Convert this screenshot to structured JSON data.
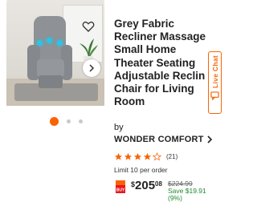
{
  "product": {
    "title_lines": [
      "Grey Fabric",
      "Recliner Massage",
      "Small Home",
      "Theater Seating",
      "Adjustable Reclin",
      "Chair for Living",
      "Room"
    ],
    "by_label": "by",
    "brand": "WONDER COMFORT",
    "rating": 4,
    "rating_count": "(21)",
    "limit_text": "Limit 10 per order",
    "price": {
      "dollar": "$",
      "whole": "205",
      "cents": "08"
    },
    "was_price": "$224.99",
    "save_amount": "Save $19.91",
    "save_percent": "(9%)"
  },
  "gallery": {
    "total_images": 3,
    "active_index": 0
  },
  "live_chat": {
    "label": "Live Chat"
  },
  "icons": {
    "favorite": "heart-icon",
    "next": "chevron-right-icon",
    "brand_chevron": "chevron-right-icon",
    "deal_badge": "buy-badge-icon",
    "chat": "chat-icon"
  },
  "colors": {
    "accent": "#f96302",
    "save": "#1f8a2e",
    "star": "#f96302"
  }
}
